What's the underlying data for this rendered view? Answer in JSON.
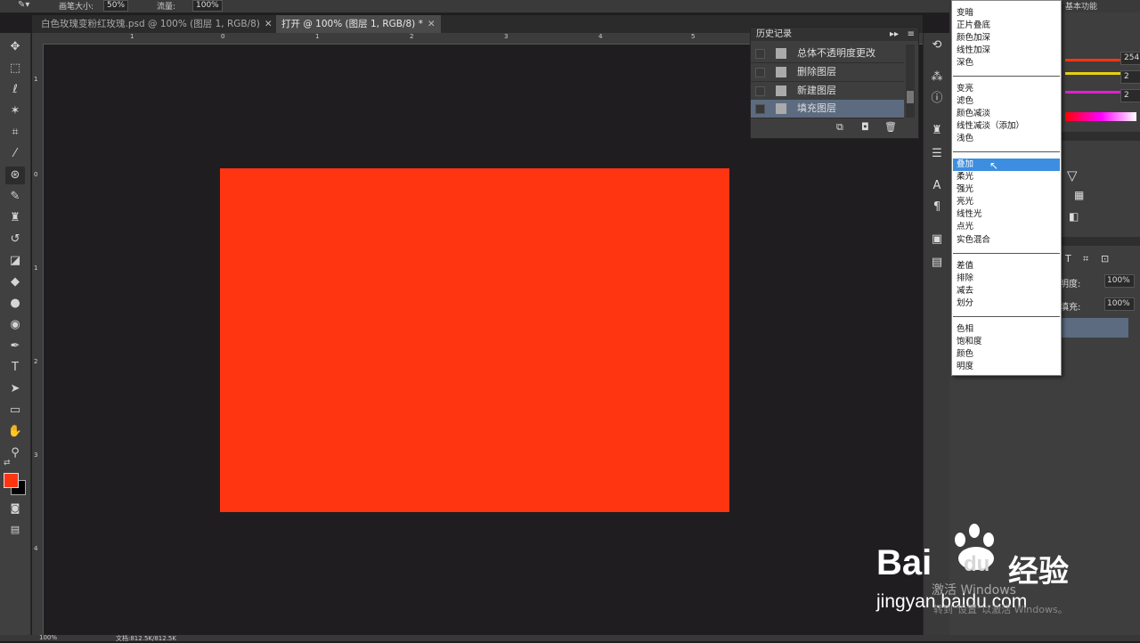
{
  "options_bar": {
    "brush_size_label": "画笔大小:",
    "brush_size_value": "50%",
    "flow_label": "流量:",
    "flow_value": "100%"
  },
  "tabs": [
    {
      "label": "白色玫瑰变粉红玫瑰.psd @ 100% (图层 1, RGB/8)",
      "active": false
    },
    {
      "label": "打开 @ 100% (图层 1, RGB/8) *",
      "active": true
    }
  ],
  "ruler": {
    "h_labels": [
      "1",
      "0",
      "1",
      "2",
      "3",
      "4",
      "5"
    ],
    "v_labels": [
      "1",
      "0",
      "1",
      "2",
      "3",
      "4"
    ]
  },
  "history": {
    "title": "历史记录",
    "items": [
      {
        "label": "总体不透明度更改",
        "selected": false
      },
      {
        "label": "删除图层",
        "selected": false
      },
      {
        "label": "新建图层",
        "selected": false
      },
      {
        "label": "填充图层",
        "selected": true
      }
    ]
  },
  "blend_modes": {
    "groups": [
      [
        "变暗",
        "正片叠底",
        "颜色加深",
        "线性加深",
        "深色"
      ],
      [
        "变亮",
        "滤色",
        "颜色减淡",
        "线性减淡（添加）",
        "浅色"
      ],
      [
        "叠加",
        "柔光",
        "强光",
        "亮光",
        "线性光",
        "点光",
        "实色混合"
      ],
      [
        "差值",
        "排除",
        "减去",
        "划分"
      ],
      [
        "色相",
        "饱和度",
        "颜色",
        "明度"
      ]
    ],
    "selected": "叠加"
  },
  "color_panel": {
    "r_value": "254",
    "g_value": "2",
    "b_value": "2"
  },
  "layers_panel": {
    "opacity_label": "明度:",
    "opacity_value": "100%",
    "fill_label": "填充:",
    "fill_value": "100%"
  },
  "workspace_label": "基本功能",
  "status_bar": {
    "zoom": "100%",
    "doc_info": "文档:812.5K/812.5K"
  },
  "watermark": {
    "brand": "Bai",
    "brand2": "du",
    "brand3": "经验",
    "url": "jingyan.baidu.com",
    "activate": "激活 Windows",
    "activate_hint": "转到\"设置\"以激活 Windows。"
  },
  "colors": {
    "canvas_fill": "#ff3512",
    "foreground": "#ff3512",
    "background": "#000000",
    "selection_blue": "#3d8ee0"
  }
}
